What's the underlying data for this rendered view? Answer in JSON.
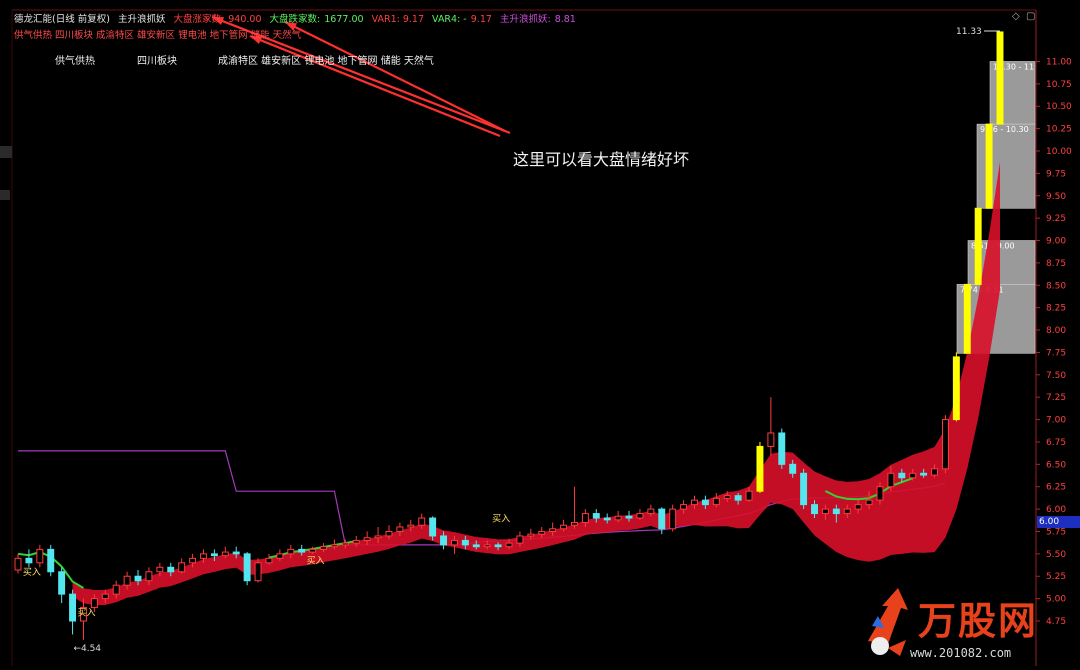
{
  "header": {
    "title": "德龙汇能(日线 前复权)",
    "indicator": "主升浪抓妖",
    "zt_label": "大盘涨家数:",
    "zt_value": "940.00",
    "dt_label": "大盘跌家数:",
    "dt_value": "1677.00",
    "var1": "VAR1: 9.17",
    "var4": "VAR4: -",
    "var4_value": "9.17",
    "zsl_label": "主升浪抓妖:",
    "zsl_value": "8.81",
    "sectors_line": "供气供热 四川板块 成渝特区 雄安新区 锂电池 地下管网 储能 天然气"
  },
  "sector_tags": [
    "供气供热",
    "四川板块",
    "成渝特区 雄安新区 锂电池 地下管网 储能 天然气"
  ],
  "annotation": "这里可以看大盘情绪好坏",
  "current_price_tag": "6.00",
  "watermark": {
    "title": "万股网",
    "url": "www.201082.com"
  },
  "colors": {
    "up": "#ff3b3b",
    "down": "#54e6ee",
    "limit": "#ffff00",
    "ribbon": "#d8102a",
    "ma": "#a53ab8",
    "accent": "#ff3030",
    "green": "#32d232"
  },
  "chart_data": {
    "type": "candlestick",
    "ylim": [
      4.5,
      11.2
    ],
    "yticks": [
      "11.00",
      "10.75",
      "10.50",
      "10.25",
      "10.00",
      "9.75",
      "9.50",
      "9.25",
      "9.00",
      "8.75",
      "8.50",
      "8.25",
      "8.00",
      "7.75",
      "7.50",
      "7.25",
      "7.00",
      "6.75",
      "6.50",
      "6.25",
      "6.00",
      "5.75",
      "5.50",
      "5.25",
      "5.00",
      "4.75"
    ],
    "low_marker": "4.54",
    "high_marker": "11.33",
    "buy_labels": [
      {
        "i": 6,
        "price": 4.97,
        "text": "买入"
      },
      {
        "i": 27,
        "price": 5.55,
        "text": "买入"
      },
      {
        "i": 44,
        "price": 6.02,
        "text": "买入"
      },
      {
        "i": 1,
        "price": 5.42,
        "text": "买入"
      }
    ],
    "price_boxes": [
      {
        "text": "10.30 - 11",
        "low": 10.3,
        "high": 11.0
      },
      {
        "text": "9.36 - 10.30",
        "low": 9.36,
        "high": 10.3
      },
      {
        "text": "8.51 - 9.00",
        "low": 8.51,
        "high": 9.0
      },
      {
        "text": "7.74 - 8.51",
        "low": 7.74,
        "high": 8.51
      }
    ],
    "candles": [
      [
        5.32,
        5.45,
        5.5,
        5.28
      ],
      [
        5.45,
        5.4,
        5.55,
        5.35
      ],
      [
        5.4,
        5.55,
        5.6,
        5.35
      ],
      [
        5.55,
        5.3,
        5.6,
        5.25
      ],
      [
        5.3,
        5.05,
        5.35,
        4.95
      ],
      [
        5.05,
        4.75,
        5.1,
        4.6
      ],
      [
        4.75,
        4.9,
        5.0,
        4.54
      ],
      [
        4.9,
        5.0,
        5.05,
        4.85
      ],
      [
        5.0,
        5.05,
        5.1,
        4.95
      ],
      [
        5.05,
        5.15,
        5.2,
        5.0
      ],
      [
        5.15,
        5.25,
        5.3,
        5.1
      ],
      [
        5.25,
        5.2,
        5.32,
        5.15
      ],
      [
        5.2,
        5.3,
        5.35,
        5.15
      ],
      [
        5.3,
        5.35,
        5.4,
        5.25
      ],
      [
        5.35,
        5.3,
        5.4,
        5.25
      ],
      [
        5.3,
        5.4,
        5.45,
        5.28
      ],
      [
        5.4,
        5.45,
        5.5,
        5.35
      ],
      [
        5.45,
        5.5,
        5.55,
        5.4
      ],
      [
        5.5,
        5.48,
        5.55,
        5.42
      ],
      [
        5.48,
        5.52,
        5.58,
        5.45
      ],
      [
        5.52,
        5.5,
        5.58,
        5.45
      ],
      [
        5.5,
        5.2,
        5.52,
        5.15
      ],
      [
        5.2,
        5.4,
        5.45,
        5.18
      ],
      [
        5.4,
        5.45,
        5.5,
        5.38
      ],
      [
        5.45,
        5.5,
        5.55,
        5.42
      ],
      [
        5.5,
        5.55,
        5.6,
        5.45
      ],
      [
        5.55,
        5.52,
        5.6,
        5.48
      ],
      [
        5.52,
        5.55,
        5.58,
        5.5
      ],
      [
        5.55,
        5.58,
        5.62,
        5.52
      ],
      [
        5.58,
        5.6,
        5.66,
        5.55
      ],
      [
        5.6,
        5.62,
        5.66,
        5.56
      ],
      [
        5.62,
        5.65,
        5.7,
        5.58
      ],
      [
        5.65,
        5.68,
        5.75,
        5.6
      ],
      [
        5.68,
        5.7,
        5.8,
        5.62
      ],
      [
        5.7,
        5.75,
        5.82,
        5.66
      ],
      [
        5.75,
        5.8,
        5.85,
        5.7
      ],
      [
        5.8,
        5.82,
        5.88,
        5.75
      ],
      [
        5.82,
        5.9,
        5.95,
        5.78
      ],
      [
        5.9,
        5.7,
        5.92,
        5.65
      ],
      [
        5.7,
        5.6,
        5.75,
        5.55
      ],
      [
        5.6,
        5.65,
        5.7,
        5.5
      ],
      [
        5.65,
        5.6,
        5.7,
        5.55
      ],
      [
        5.6,
        5.58,
        5.65,
        5.55
      ],
      [
        5.58,
        5.6,
        5.65,
        5.55
      ],
      [
        5.6,
        5.58,
        5.63,
        5.54
      ],
      [
        5.58,
        5.62,
        5.67,
        5.55
      ],
      [
        5.62,
        5.7,
        5.75,
        5.58
      ],
      [
        5.7,
        5.72,
        5.78,
        5.66
      ],
      [
        5.72,
        5.75,
        5.8,
        5.68
      ],
      [
        5.75,
        5.78,
        5.85,
        5.7
      ],
      [
        5.78,
        5.82,
        5.88,
        5.75
      ],
      [
        5.82,
        5.85,
        6.25,
        5.78
      ],
      [
        5.85,
        5.95,
        6.0,
        5.8
      ],
      [
        5.95,
        5.9,
        6.0,
        5.85
      ],
      [
        5.9,
        5.88,
        5.95,
        5.84
      ],
      [
        5.88,
        5.92,
        5.98,
        5.85
      ],
      [
        5.92,
        5.9,
        5.98,
        5.86
      ],
      [
        5.9,
        5.95,
        6.0,
        5.88
      ],
      [
        5.95,
        6.0,
        6.05,
        5.92
      ],
      [
        6.0,
        5.78,
        6.02,
        5.72
      ],
      [
        5.78,
        6.0,
        6.05,
        5.75
      ],
      [
        6.0,
        6.05,
        6.1,
        5.95
      ],
      [
        6.05,
        6.1,
        6.15,
        6.0
      ],
      [
        6.1,
        6.05,
        6.15,
        6.0
      ],
      [
        6.05,
        6.12,
        6.18,
        6.02
      ],
      [
        6.12,
        6.15,
        6.2,
        6.08
      ],
      [
        6.15,
        6.1,
        6.18,
        6.05
      ],
      [
        6.1,
        6.2,
        6.25,
        6.08
      ],
      [
        6.2,
        6.7,
        6.75,
        6.18
      ],
      [
        6.7,
        6.85,
        7.25,
        6.6
      ],
      [
        6.85,
        6.5,
        6.9,
        6.45
      ],
      [
        6.5,
        6.4,
        6.55,
        6.35
      ],
      [
        6.4,
        6.05,
        6.45,
        6.0
      ],
      [
        6.05,
        5.95,
        6.1,
        5.9
      ],
      [
        5.95,
        6.0,
        6.05,
        5.88
      ],
      [
        6.0,
        5.95,
        6.05,
        5.85
      ],
      [
        5.95,
        6.0,
        6.05,
        5.9
      ],
      [
        6.0,
        6.05,
        6.1,
        5.95
      ],
      [
        6.05,
        6.1,
        6.2,
        6.0
      ],
      [
        6.1,
        6.25,
        6.3,
        6.05
      ],
      [
        6.25,
        6.4,
        6.48,
        6.2
      ],
      [
        6.4,
        6.35,
        6.45,
        6.3
      ],
      [
        6.35,
        6.4,
        6.45,
        6.32
      ],
      [
        6.4,
        6.38,
        6.45,
        6.35
      ],
      [
        6.38,
        6.45,
        6.5,
        6.35
      ],
      [
        6.45,
        7.0,
        7.05,
        6.4
      ],
      [
        7.0,
        7.7,
        7.75,
        6.98
      ],
      [
        7.74,
        8.51,
        8.51,
        7.74
      ],
      [
        8.51,
        9.36,
        9.36,
        8.51
      ],
      [
        9.36,
        10.3,
        10.3,
        9.36
      ],
      [
        10.3,
        11.33,
        11.33,
        10.3
      ]
    ]
  }
}
